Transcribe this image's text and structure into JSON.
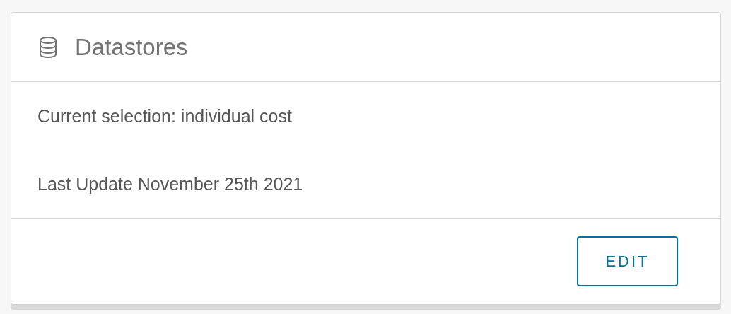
{
  "card": {
    "title": "Datastores",
    "lines": [
      "Current selection: individual cost",
      "Last Update November 25th 2021"
    ],
    "buttons": [
      "EDIT"
    ]
  }
}
